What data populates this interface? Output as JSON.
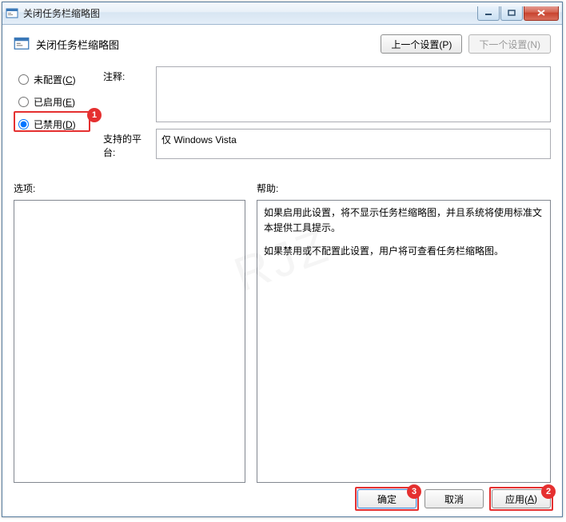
{
  "window": {
    "title": "关闭任务栏缩略图"
  },
  "header": {
    "title": "关闭任务栏缩略图",
    "prev_btn": "上一个设置(P)",
    "next_btn": "下一个设置(N)"
  },
  "radios": {
    "not_configured": "未配置(C)",
    "enabled": "已启用(E)",
    "disabled": "已禁用(D)",
    "selected": "disabled"
  },
  "fields": {
    "comment_label": "注释:",
    "comment_value": "",
    "platform_label": "支持的平台:",
    "platform_value": "仅 Windows Vista"
  },
  "lower": {
    "options_label": "选项:",
    "help_label": "帮助:",
    "help_p1": "如果启用此设置，将不显示任务栏缩略图，并且系统将使用标准文本提供工具提示。",
    "help_p2": "如果禁用或不配置此设置，用户将可查看任务栏缩略图。"
  },
  "footer": {
    "ok": "确定",
    "cancel": "取消",
    "apply": "应用(A)"
  },
  "annotations": {
    "b1": "1",
    "b2": "2",
    "b3": "3"
  }
}
